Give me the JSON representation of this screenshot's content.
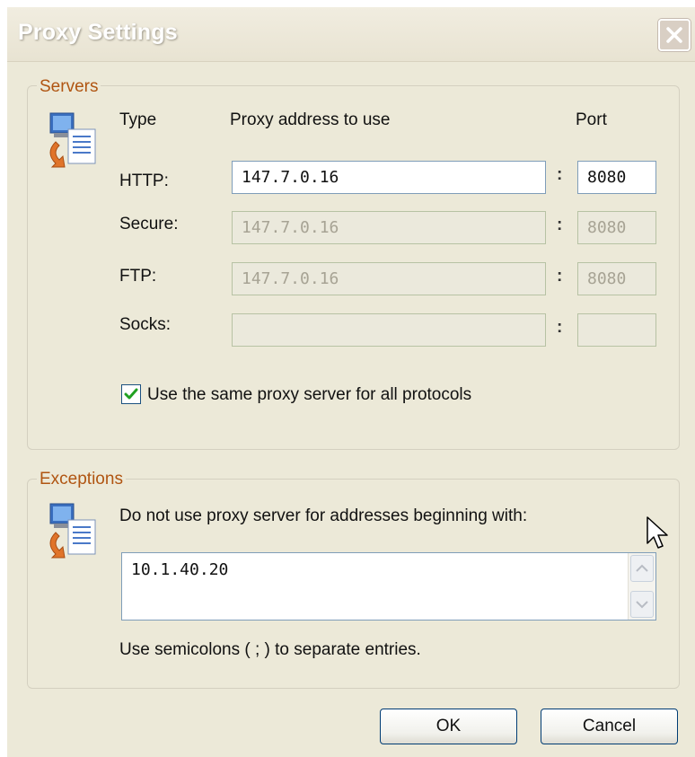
{
  "window": {
    "title": "Proxy Settings"
  },
  "servers": {
    "legend": "Servers",
    "headers": {
      "type": "Type",
      "address": "Proxy address to use",
      "port": "Port"
    },
    "rows": [
      {
        "label": "HTTP:",
        "address": "147.7.0.16",
        "port": "8080",
        "enabled": true
      },
      {
        "label": "Secure:",
        "address": "147.7.0.16",
        "port": "8080",
        "enabled": false
      },
      {
        "label": "FTP:",
        "address": "147.7.0.16",
        "port": "8080",
        "enabled": false
      },
      {
        "label": "Socks:",
        "address": "",
        "port": "",
        "enabled": false
      }
    ],
    "colon": ":",
    "same_proxy": {
      "label": "Use the same proxy server for all protocols",
      "checked": true
    }
  },
  "exceptions": {
    "legend": "Exceptions",
    "description": "Do not use proxy server for addresses beginning with:",
    "value": "10.1.40.20",
    "hint": "Use semicolons ( ; ) to separate entries."
  },
  "buttons": {
    "ok": "OK",
    "cancel": "Cancel"
  },
  "colors": {
    "legend": "#b05512",
    "dialog_bg": "#ece9d8",
    "field_border": "#7f9db9",
    "check_green": "#21a121"
  },
  "icons": {
    "servers": "network-computer-icon",
    "exceptions": "network-computer-icon",
    "close": "close-icon"
  }
}
